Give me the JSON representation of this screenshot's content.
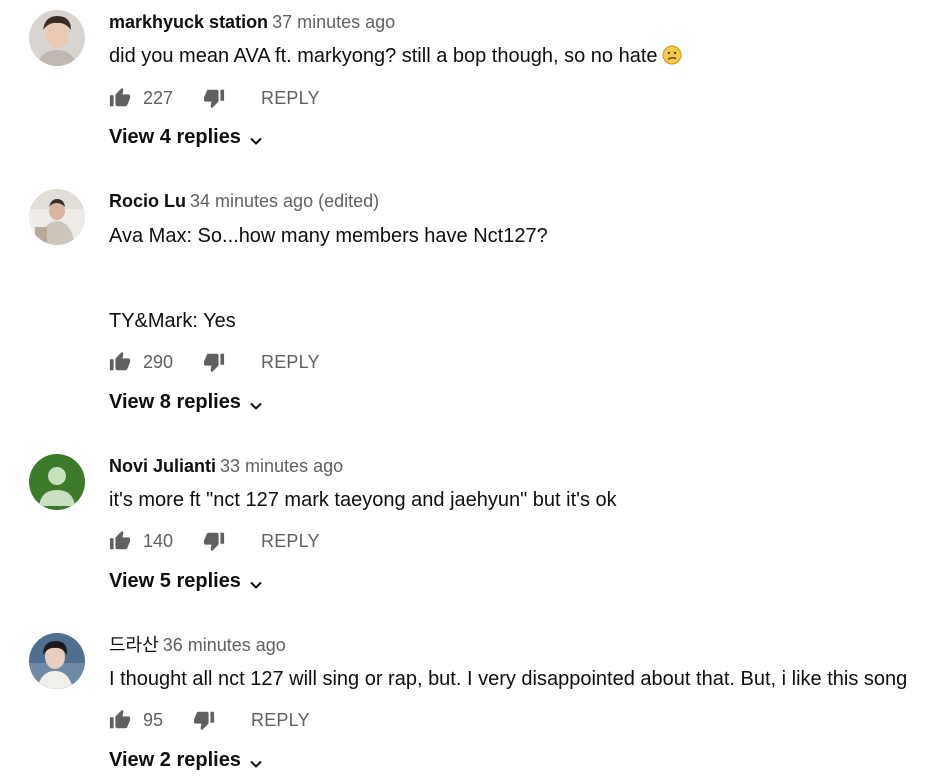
{
  "comments": [
    {
      "author": "markhyuck station",
      "time": "37 minutes ago",
      "text": [
        "did you mean AVA ft. markyong? still a bop though, so no hate"
      ],
      "emoji": "confused-face",
      "likes": "227",
      "reply_label": "REPLY",
      "view_replies": "View 4 replies"
    },
    {
      "author": "Rocio Lu",
      "time": "34 minutes ago (edited)",
      "text": [
        "Ava Max: So...how many members have Nct127?",
        "TY&Mark: Yes"
      ],
      "likes": "290",
      "reply_label": "REPLY",
      "view_replies": "View 8 replies"
    },
    {
      "author": "Novi Julianti",
      "time": "33 minutes ago",
      "text": [
        "it's more ft \"nct 127 mark taeyong and jaehyun\" but it's ok"
      ],
      "likes": "140",
      "reply_label": "REPLY",
      "view_replies": "View 5 replies"
    },
    {
      "author": "드라산",
      "time": "36 minutes ago",
      "text": [
        "I thought all nct 127 will sing or rap, but. I very disappointed about that. But, i like this song"
      ],
      "likes": "95",
      "reply_label": "REPLY",
      "view_replies": "View 2 replies"
    }
  ],
  "icons": {
    "like": "thumbs-up-icon",
    "dislike": "thumbs-down-icon",
    "expand": "chevron-down-icon"
  },
  "colors": {
    "primary_text": "#0f0f0f",
    "secondary_text": "#606060",
    "default_avatar_bg": "#3d7a2a"
  }
}
